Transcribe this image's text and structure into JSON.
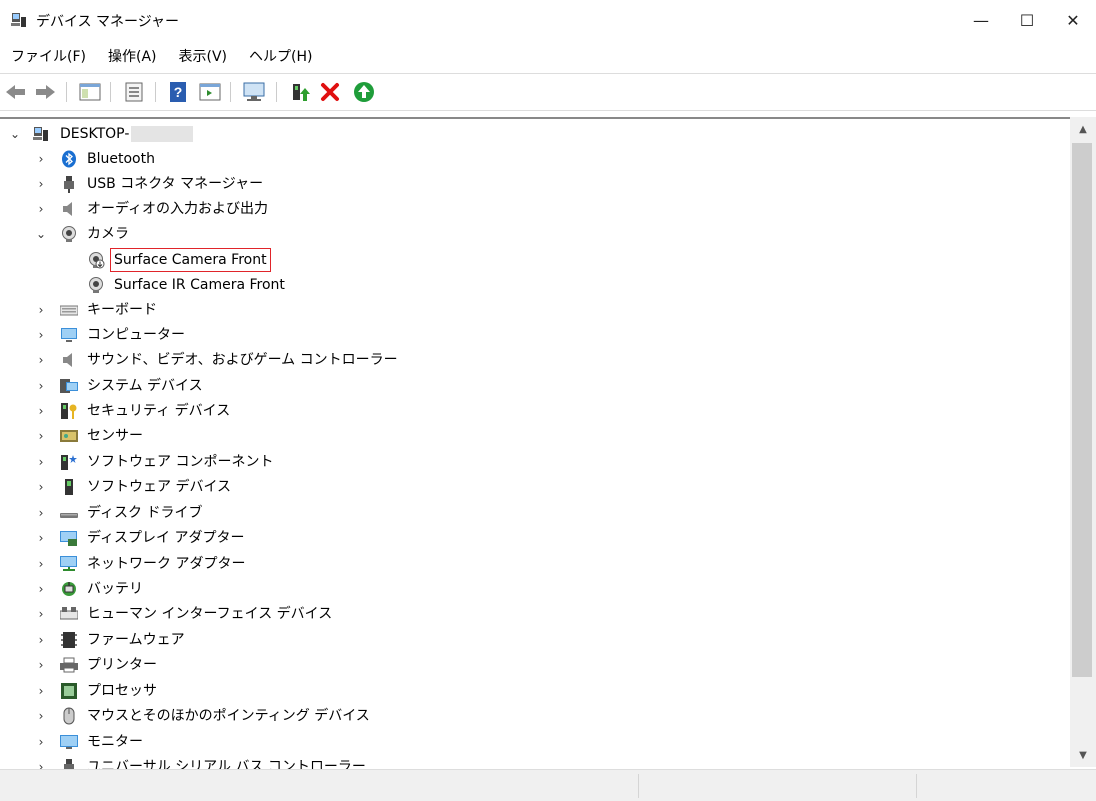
{
  "window": {
    "title": "デバイス マネージャー",
    "controls": {
      "minimize": "—",
      "maximize": "☐",
      "close": "✕"
    }
  },
  "menu": [
    "ファイル(F)",
    "操作(A)",
    "表示(V)",
    "ヘルプ(H)"
  ],
  "toolbar": [
    {
      "name": "back-icon"
    },
    {
      "name": "forward-icon"
    },
    {
      "name": "show-hide-console-tree-icon"
    },
    {
      "name": "properties-icon"
    },
    {
      "name": "help-icon"
    },
    {
      "name": "action-pane-icon"
    },
    {
      "name": "scan-hardware-icon"
    },
    {
      "name": "update-driver-icon"
    },
    {
      "name": "uninstall-device-icon"
    },
    {
      "name": "enable-device-icon"
    }
  ],
  "tree": {
    "root": {
      "label": "DESKTOP-",
      "expanded": true
    },
    "items": [
      {
        "label": "Bluetooth",
        "icon": "bluetooth-icon",
        "expanded": false
      },
      {
        "label": "USB コネクタ マネージャー",
        "icon": "usb-icon",
        "expanded": false
      },
      {
        "label": "オーディオの入力および出力",
        "icon": "speaker-icon",
        "expanded": false
      },
      {
        "label": "カメラ",
        "icon": "camera-icon",
        "expanded": true,
        "children": [
          {
            "label": "Surface Camera Front",
            "icon": "camera-icon",
            "selected": true
          },
          {
            "label": "Surface IR Camera Front",
            "icon": "camera-icon",
            "selected": false
          }
        ]
      },
      {
        "label": "キーボード",
        "icon": "keyboard-icon",
        "expanded": false
      },
      {
        "label": "コンピューター",
        "icon": "computer-icon",
        "expanded": false
      },
      {
        "label": "サウンド、ビデオ、およびゲーム コントローラー",
        "icon": "speaker-icon",
        "expanded": false
      },
      {
        "label": "システム デバイス",
        "icon": "system-devices-icon",
        "expanded": false
      },
      {
        "label": "セキュリティ デバイス",
        "icon": "security-key-icon",
        "expanded": false
      },
      {
        "label": "センサー",
        "icon": "sensor-icon",
        "expanded": false
      },
      {
        "label": "ソフトウェア コンポーネント",
        "icon": "software-component-icon",
        "expanded": false
      },
      {
        "label": "ソフトウェア デバイス",
        "icon": "software-device-icon",
        "expanded": false
      },
      {
        "label": "ディスク ドライブ",
        "icon": "disk-drive-icon",
        "expanded": false
      },
      {
        "label": "ディスプレイ アダプター",
        "icon": "display-adapter-icon",
        "expanded": false
      },
      {
        "label": "ネットワーク アダプター",
        "icon": "network-adapter-icon",
        "expanded": false
      },
      {
        "label": "バッテリ",
        "icon": "battery-icon",
        "expanded": false
      },
      {
        "label": "ヒューマン インターフェイス デバイス",
        "icon": "hid-icon",
        "expanded": false
      },
      {
        "label": "ファームウェア",
        "icon": "firmware-icon",
        "expanded": false
      },
      {
        "label": "プリンター",
        "icon": "printer-icon",
        "expanded": false
      },
      {
        "label": "プロセッサ",
        "icon": "processor-icon",
        "expanded": false
      },
      {
        "label": "マウスとそのほかのポインティング デバイス",
        "icon": "mouse-icon",
        "expanded": false
      },
      {
        "label": "モニター",
        "icon": "monitor-icon",
        "expanded": false
      },
      {
        "label": "ユニバーサル シリアル バス コントローラー",
        "icon": "usb-controller-icon",
        "expanded": false
      }
    ]
  }
}
